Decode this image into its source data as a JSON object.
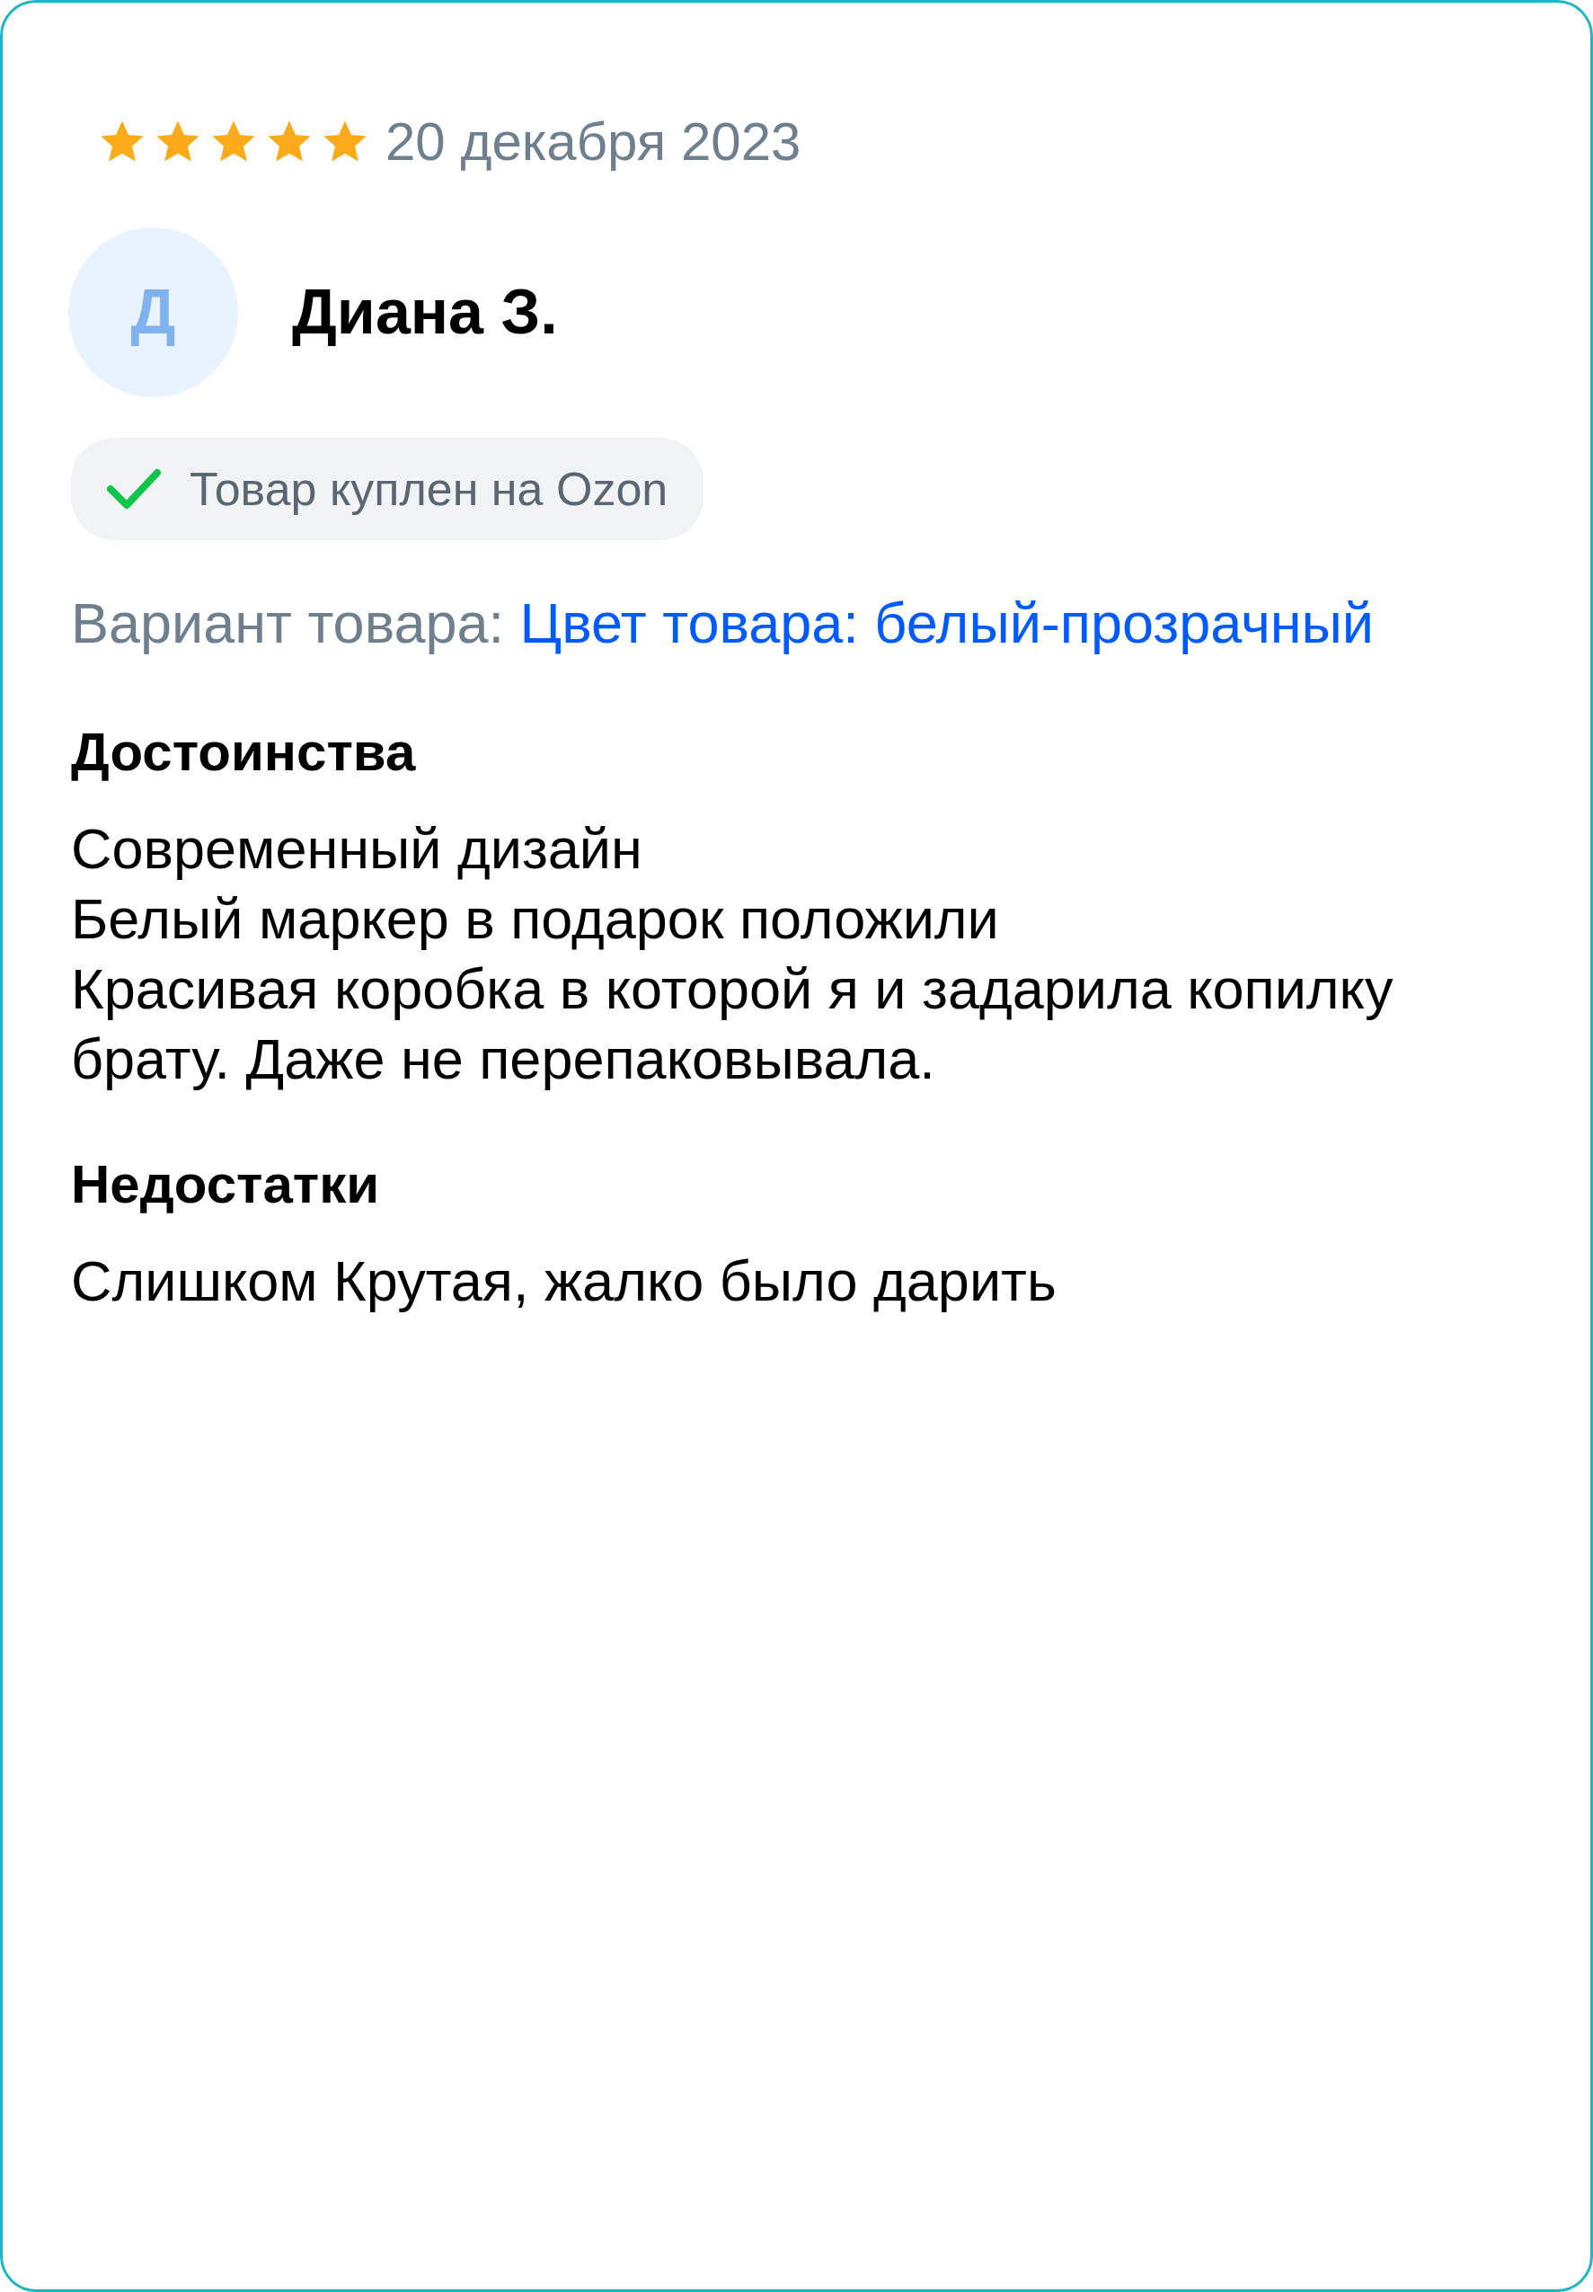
{
  "review": {
    "stars": 5,
    "date": "20 декабря 2023",
    "author": {
      "initial": "Д",
      "name": "Диана З."
    },
    "verified": {
      "shown": true,
      "label": "Товар куплен на Ozon"
    },
    "variant": {
      "label": "Вариант товара:",
      "value": "Цвет товара: белый-прозрачный"
    },
    "sections": [
      {
        "title": "Достоинства",
        "lines": [
          "Современный дизайн",
          "Белый маркер в подарок положили",
          "Красивая коробка в которой я и задарила копилку брату. Даже не перепаковывала."
        ]
      },
      {
        "title": "Недостатки",
        "lines": [
          "Слишком Крутая, жалко было дарить"
        ]
      }
    ]
  }
}
